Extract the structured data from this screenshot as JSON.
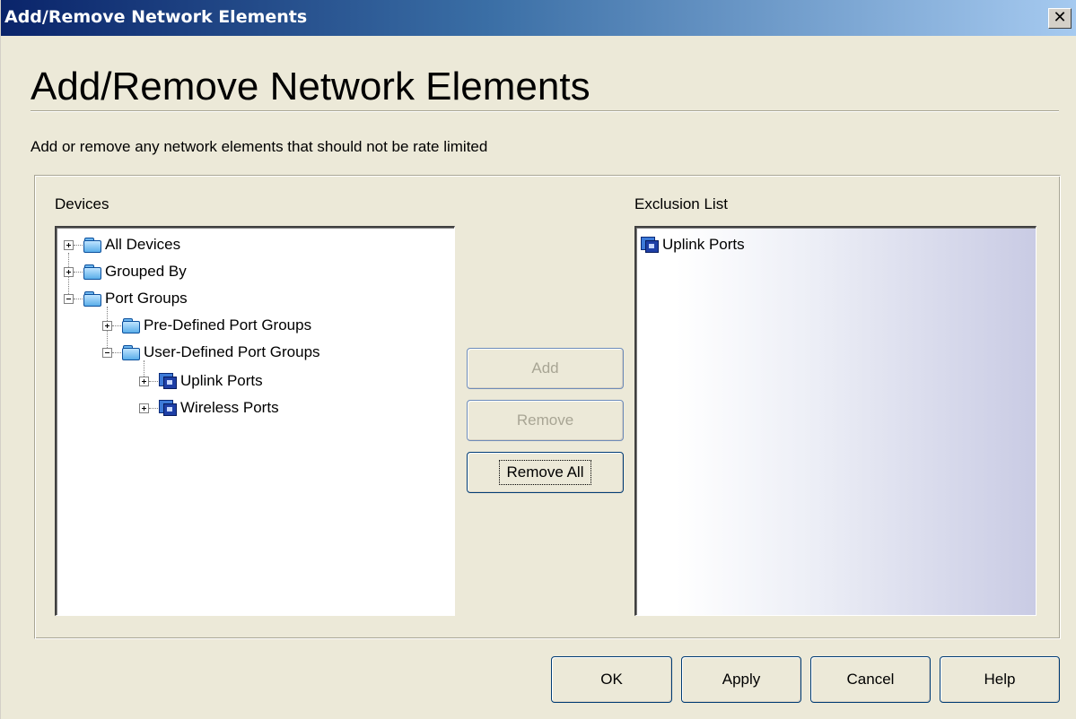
{
  "window": {
    "title": "Add/Remove Network Elements",
    "close_glyph": "✕"
  },
  "heading": "Add/Remove Network Elements",
  "description": "Add or remove any network elements that should not be rate limited",
  "devices": {
    "label": "Devices",
    "tree": [
      {
        "label": "All Devices",
        "icon": "folder-icon",
        "expander": "plus",
        "level": 0
      },
      {
        "label": "Grouped By",
        "icon": "folder-icon",
        "expander": "plus",
        "level": 0
      },
      {
        "label": "Port Groups",
        "icon": "open-folder-icon",
        "expander": "minus",
        "level": 0
      },
      {
        "label": "Pre-Defined Port Groups",
        "icon": "folder-icon",
        "expander": "plus",
        "level": 1
      },
      {
        "label": "User-Defined Port Groups",
        "icon": "open-folder-icon",
        "expander": "minus",
        "level": 1
      },
      {
        "label": "Uplink Ports",
        "icon": "port-group-icon",
        "expander": "plus",
        "level": 2
      },
      {
        "label": "Wireless Ports",
        "icon": "port-group-icon",
        "expander": "plus",
        "level": 2
      }
    ]
  },
  "exclusion": {
    "label": "Exclusion List",
    "items": [
      {
        "label": "Uplink Ports",
        "icon": "port-group-icon"
      }
    ]
  },
  "buttons": {
    "add": "Add",
    "remove": "Remove",
    "remove_all": "Remove All",
    "ok": "OK",
    "apply": "Apply",
    "cancel": "Cancel",
    "help": "Help"
  }
}
